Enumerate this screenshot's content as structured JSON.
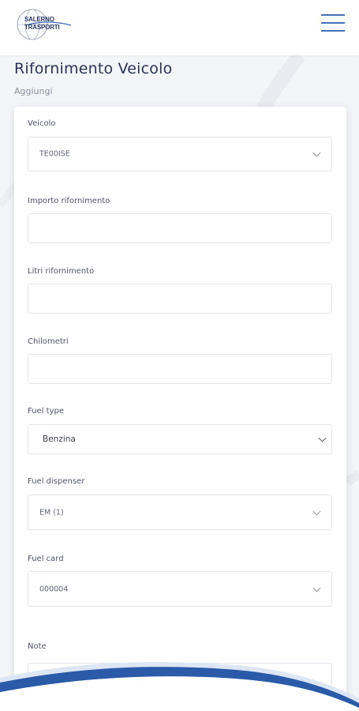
{
  "header": {
    "logo_line1": "SALERNO",
    "logo_line2": "TRASPORTI",
    "menu_icon": "hamburger-menu-icon"
  },
  "page": {
    "title": "Rifornimento Veicolo",
    "subtitle": "Aggiungi"
  },
  "form": {
    "vehicle": {
      "label": "Veicolo",
      "value": "TE00ISE"
    },
    "amount": {
      "label": "Importo rifornimento",
      "value": ""
    },
    "liters": {
      "label": "Litri rifornimento",
      "value": ""
    },
    "km": {
      "label": "Chilometri",
      "value": ""
    },
    "fuel_type": {
      "label": "Fuel type",
      "value": "Benzina"
    },
    "fuel_dispenser": {
      "label": "Fuel dispenser",
      "value": "EM (1)"
    },
    "fuel_card": {
      "label": "Fuel card",
      "value": "000004"
    },
    "note": {
      "label": "Note"
    }
  },
  "colors": {
    "accent": "#4470b8",
    "title": "#2b3557",
    "wave_dark": "#2a5aa8",
    "wave_light": "#d9e4f3"
  }
}
